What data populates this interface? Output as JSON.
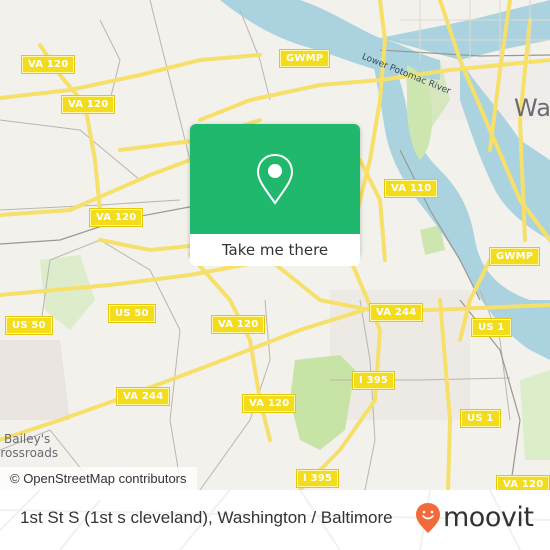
{
  "map": {
    "colors": {
      "land": "#f2f1ec",
      "water": "#aad3df",
      "park": "#cde6b0",
      "road_major": "#f6e06a",
      "road_minor": "#b9b6b0",
      "urban": "#e8e0de",
      "popup_green": "#1fb86c",
      "brand_orange": "#f26b3a"
    },
    "route_shields": [
      {
        "label": "VA 120"
      },
      {
        "label": "VA 120"
      },
      {
        "label": "VA 120"
      },
      {
        "label": "VA 120"
      },
      {
        "label": "VA 120"
      },
      {
        "label": "VA 120"
      },
      {
        "label": "GWMP"
      },
      {
        "label": "GWMP"
      },
      {
        "label": "VA 110"
      },
      {
        "label": "US 50"
      },
      {
        "label": "US 50"
      },
      {
        "label": "VA 244"
      },
      {
        "label": "VA 244"
      },
      {
        "label": "US 1"
      },
      {
        "label": "US 1"
      },
      {
        "label": "I 395"
      },
      {
        "label": "I 395"
      }
    ],
    "place_labels": {
      "washington": "Was",
      "baileys_line1": "Bailey's",
      "baileys_line2": "Crossroads",
      "river": "Lower Potomac River"
    },
    "attribution": "© OpenStreetMap contributors"
  },
  "popup": {
    "icon": "map-pin-icon",
    "button_label": "Take me there"
  },
  "footer": {
    "address": "1st St S (1st s cleveland), Washington / Baltimore",
    "brand": "moovit",
    "brand_icon": "moovit-pin-smile-icon"
  }
}
